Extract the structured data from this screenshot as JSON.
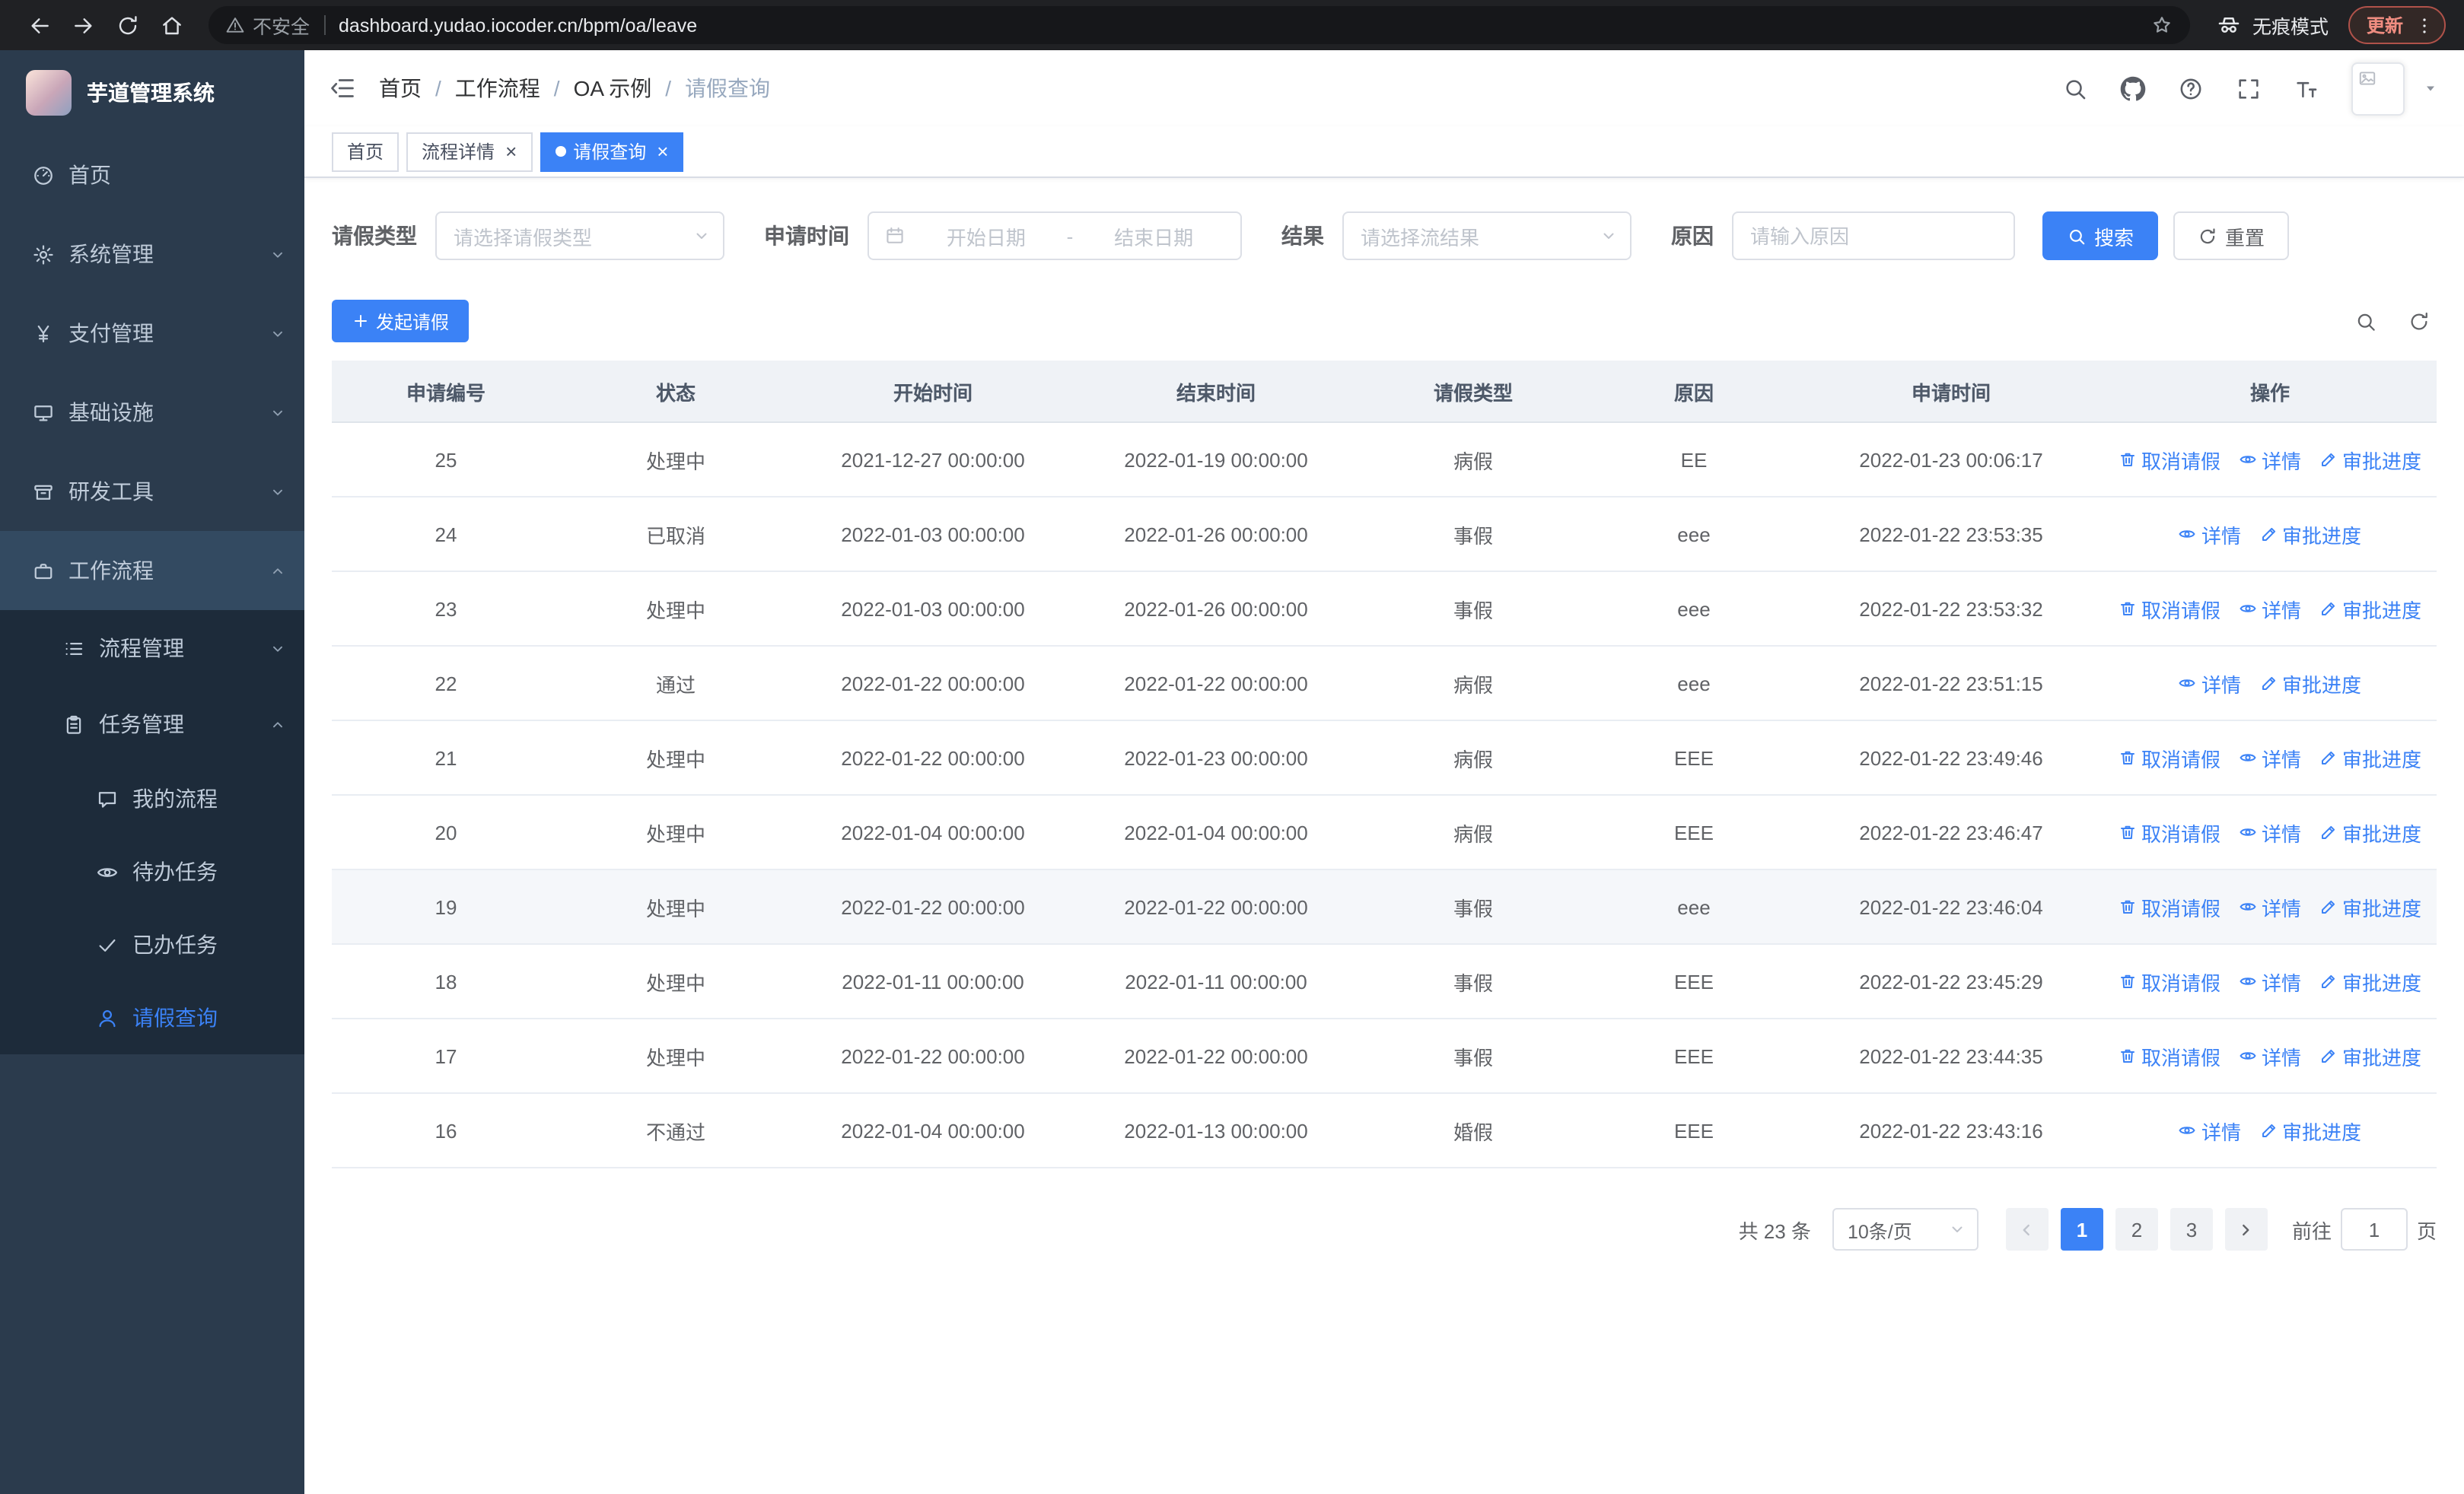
{
  "theme": {
    "primary": "#3b82f6",
    "sidebar_bg": "#2b3b4d",
    "sidebar_submenu_bg": "#1d2b3a"
  },
  "browser": {
    "security_warning": "不安全",
    "url": "dashboard.yudao.iocoder.cn/bpm/oa/leave",
    "incognito_label": "无痕模式",
    "update_label": "更新"
  },
  "sidebar": {
    "logo_title": "芋道管理系统",
    "items": [
      {
        "key": "home",
        "label": "首页",
        "icon": "dashboard-icon",
        "level": 1
      },
      {
        "key": "system",
        "label": "系统管理",
        "icon": "gear-icon",
        "level": 1,
        "chevron": "down"
      },
      {
        "key": "payment",
        "label": "支付管理",
        "icon": "yen-icon",
        "level": 1,
        "chevron": "down"
      },
      {
        "key": "infrastructure",
        "label": "基础设施",
        "icon": "monitor-icon",
        "level": 1,
        "chevron": "down"
      },
      {
        "key": "dev-tools",
        "label": "研发工具",
        "icon": "toolbox-icon",
        "level": 1,
        "chevron": "down"
      },
      {
        "key": "workflow",
        "label": "工作流程",
        "icon": "briefcase-icon",
        "level": 1,
        "chevron": "up",
        "highlighted": true
      },
      {
        "key": "process-mgmt",
        "label": "流程管理",
        "icon": "flow-list-icon",
        "level": 2,
        "chevron": "down"
      },
      {
        "key": "task-mgmt",
        "label": "任务管理",
        "icon": "clipboard-icon",
        "level": 2,
        "chevron": "up"
      },
      {
        "key": "my-process",
        "label": "我的流程",
        "icon": "chat-icon",
        "level": 3
      },
      {
        "key": "todo-tasks",
        "label": "待办任务",
        "icon": "eye-icon",
        "level": 3
      },
      {
        "key": "done-tasks",
        "label": "已办任务",
        "icon": "check-icon",
        "level": 3
      },
      {
        "key": "leave-query",
        "label": "请假查询",
        "icon": "user-icon",
        "level": 3,
        "active": true
      }
    ]
  },
  "header": {
    "breadcrumb": [
      "首页",
      "工作流程",
      "OA 示例",
      "请假查询"
    ],
    "breadcrumb_separator": "/"
  },
  "tabs": {
    "close_glyph": "×",
    "items": [
      {
        "key": "home",
        "label": "首页",
        "closable": false,
        "active": false
      },
      {
        "key": "process-detail",
        "label": "流程详情",
        "closable": true,
        "active": false
      },
      {
        "key": "leave-query",
        "label": "请假查询",
        "closable": true,
        "active": true
      }
    ]
  },
  "filters": {
    "leave_type_label": "请假类型",
    "leave_type_placeholder": "请选择请假类型",
    "apply_time_label": "申请时间",
    "start_date_placeholder": "开始日期",
    "range_separator": "-",
    "end_date_placeholder": "结束日期",
    "result_label": "结果",
    "result_placeholder": "请选择流结果",
    "reason_label": "原因",
    "reason_placeholder": "请输入原因",
    "search_label": "搜索",
    "reset_label": "重置"
  },
  "toolbar": {
    "create_label": "发起请假"
  },
  "table": {
    "columns": [
      "申请编号",
      "状态",
      "开始时间",
      "结束时间",
      "请假类型",
      "原因",
      "申请时间",
      "操作"
    ],
    "action_labels": {
      "cancel": "取消请假",
      "detail": "详情",
      "progress": "审批进度"
    },
    "rows": [
      {
        "id": "25",
        "status": "处理中",
        "start": "2021-12-27 00:00:00",
        "end": "2022-01-19 00:00:00",
        "type": "病假",
        "reason": "EE",
        "applied": "2022-01-23 00:06:17",
        "actions": [
          "cancel",
          "detail",
          "progress"
        ],
        "highlight": false
      },
      {
        "id": "24",
        "status": "已取消",
        "start": "2022-01-03 00:00:00",
        "end": "2022-01-26 00:00:00",
        "type": "事假",
        "reason": "eee",
        "applied": "2022-01-22 23:53:35",
        "actions": [
          "detail",
          "progress"
        ],
        "highlight": false
      },
      {
        "id": "23",
        "status": "处理中",
        "start": "2022-01-03 00:00:00",
        "end": "2022-01-26 00:00:00",
        "type": "事假",
        "reason": "eee",
        "applied": "2022-01-22 23:53:32",
        "actions": [
          "cancel",
          "detail",
          "progress"
        ],
        "highlight": false
      },
      {
        "id": "22",
        "status": "通过",
        "start": "2022-01-22 00:00:00",
        "end": "2022-01-22 00:00:00",
        "type": "病假",
        "reason": "eee",
        "applied": "2022-01-22 23:51:15",
        "actions": [
          "detail",
          "progress"
        ],
        "highlight": false
      },
      {
        "id": "21",
        "status": "处理中",
        "start": "2022-01-22 00:00:00",
        "end": "2022-01-23 00:00:00",
        "type": "病假",
        "reason": "EEE",
        "applied": "2022-01-22 23:49:46",
        "actions": [
          "cancel",
          "detail",
          "progress"
        ],
        "highlight": false
      },
      {
        "id": "20",
        "status": "处理中",
        "start": "2022-01-04 00:00:00",
        "end": "2022-01-04 00:00:00",
        "type": "病假",
        "reason": "EEE",
        "applied": "2022-01-22 23:46:47",
        "actions": [
          "cancel",
          "detail",
          "progress"
        ],
        "highlight": false
      },
      {
        "id": "19",
        "status": "处理中",
        "start": "2022-01-22 00:00:00",
        "end": "2022-01-22 00:00:00",
        "type": "事假",
        "reason": "eee",
        "applied": "2022-01-22 23:46:04",
        "actions": [
          "cancel",
          "detail",
          "progress"
        ],
        "highlight": true
      },
      {
        "id": "18",
        "status": "处理中",
        "start": "2022-01-11 00:00:00",
        "end": "2022-01-11 00:00:00",
        "type": "事假",
        "reason": "EEE",
        "applied": "2022-01-22 23:45:29",
        "actions": [
          "cancel",
          "detail",
          "progress"
        ],
        "highlight": false
      },
      {
        "id": "17",
        "status": "处理中",
        "start": "2022-01-22 00:00:00",
        "end": "2022-01-22 00:00:00",
        "type": "事假",
        "reason": "EEE",
        "applied": "2022-01-22 23:44:35",
        "actions": [
          "cancel",
          "detail",
          "progress"
        ],
        "highlight": false
      },
      {
        "id": "16",
        "status": "不通过",
        "start": "2022-01-04 00:00:00",
        "end": "2022-01-13 00:00:00",
        "type": "婚假",
        "reason": "EEE",
        "applied": "2022-01-22 23:43:16",
        "actions": [
          "detail",
          "progress"
        ],
        "highlight": false
      }
    ]
  },
  "pagination": {
    "total_label": "共 23 条",
    "page_size": "10条/页",
    "pages": [
      "1",
      "2",
      "3"
    ],
    "active_page": "1",
    "goto_label": "前往",
    "goto_value": "1",
    "page_suffix": "页"
  }
}
